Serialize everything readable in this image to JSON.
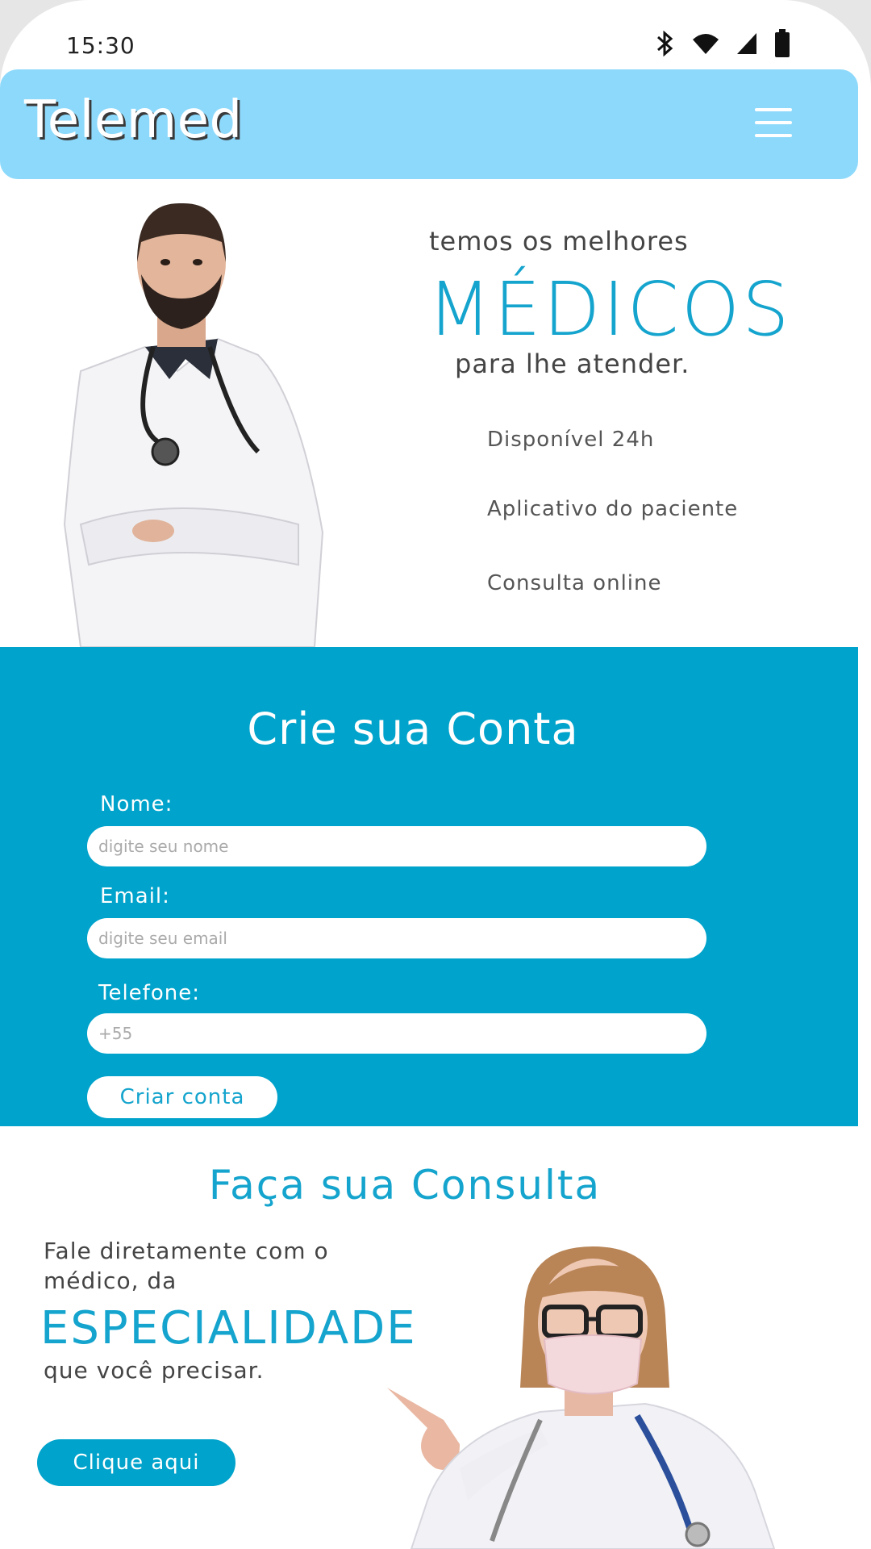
{
  "status_bar": {
    "time": "15:30",
    "icons": [
      "bluetooth-icon",
      "wifi-icon",
      "signal-icon",
      "battery-icon"
    ]
  },
  "header": {
    "brand": "Telemed",
    "menu_icon": "hamburger-menu-icon"
  },
  "hero": {
    "line1": "temos os melhores",
    "highlight": "MÉDICOS",
    "line2": "para lhe atender.",
    "features": [
      "Disponível 24h",
      "Aplicativo do paciente",
      "Consulta online"
    ]
  },
  "signup": {
    "title": "Crie sua Conta",
    "fields": [
      {
        "label": "Nome:",
        "placeholder": "digite seu nome"
      },
      {
        "label": "Email:",
        "placeholder": "digite seu email"
      },
      {
        "label": "Telefone:",
        "placeholder": "+55"
      }
    ],
    "submit_label": "Criar conta"
  },
  "consulta": {
    "title": "Faça sua Consulta",
    "text1": "Fale diretamente com o médico, da",
    "highlight": "ESPECIALIDADE",
    "text2": "que você precisar.",
    "button_label": "Clique aqui"
  },
  "colors": {
    "accent": "#00a3cb",
    "header": "#8dd9fb",
    "text": "#444444"
  }
}
